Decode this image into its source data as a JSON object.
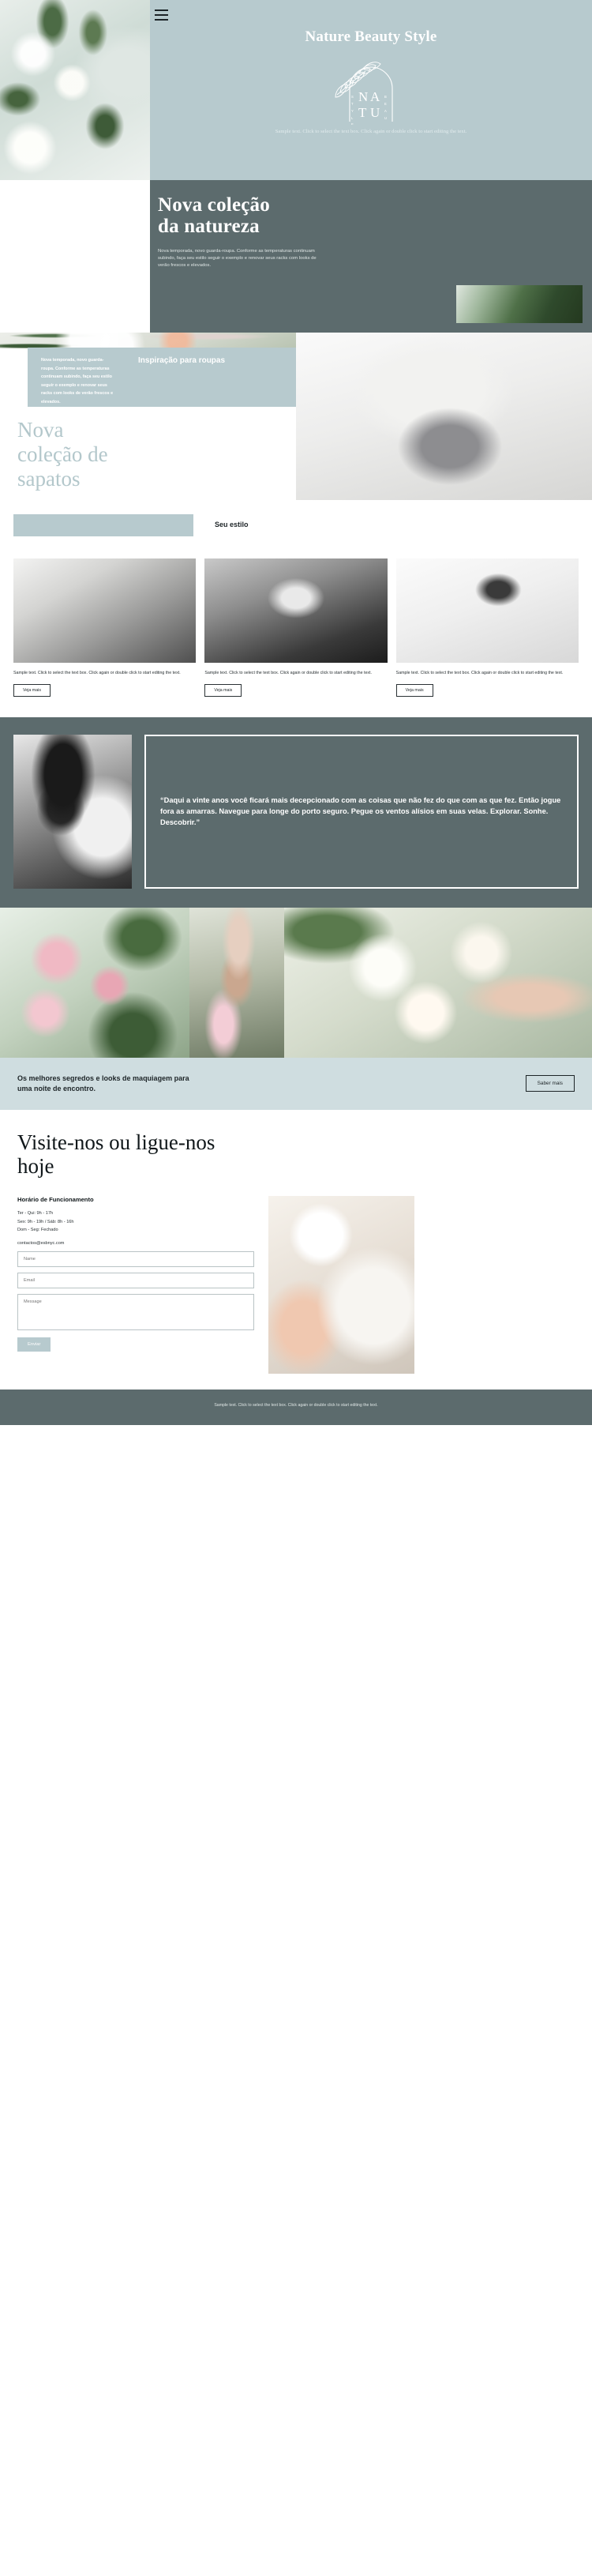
{
  "hero": {
    "menu_icon": "hamburger-menu-icon",
    "title": "Nature Beauty Style",
    "emblem": {
      "letters_center_top": "NA",
      "letters_center_bottom": "TU",
      "left_vertical": "STYLE",
      "right_vertical": "BEAUTY"
    },
    "sample_text": "Sample text. Click to select the text box. Click again or double click to start editing the text."
  },
  "section_nature": {
    "title_line1": "Nova coleção",
    "title_line2": "da natureza",
    "paragraph": "Nova temporada, novo guarda-roupa. Conforme as temperaturas continuam subindo, faça seu estilo seguir o exemplo e renovar seus racks com looks de verão frescos e elevados."
  },
  "section_shoes": {
    "band_text": "Nova temporada, novo guarda-roupa. Conforme as temperaturas continuam subindo, faça seu estilo seguir o exemplo e renovar seus racks com looks de verão frescos e elevados.",
    "band_title": "Inspiração para roupas",
    "heading_line1": "Nova",
    "heading_line2": "coleção de",
    "heading_line3": "sapatos"
  },
  "section_style": {
    "subtitle": "Seu estilo",
    "cards": [
      {
        "text": "Sample text. Click to select the text box. Click again or double click to start editing the text.",
        "button": "Veja mais"
      },
      {
        "text": "Sample text. Click to select the text box. Click again or double click to start editing the text.",
        "button": "Veja mais"
      },
      {
        "text": "Sample text. Click to select the text box. Click again or double click to start editing the text.",
        "button": "Veja mais"
      }
    ]
  },
  "section_quote": {
    "quote": "“Daqui a vinte anos você ficará mais decepcionado com as coisas que não fez do que com as que fez. Então jogue fora as amarras. Navegue para longe do porto seguro. Pegue os ventos alísios em suas velas. Explorar. Sonhe. Descobrir.”"
  },
  "section_makeup": {
    "text": "Os melhores segredos e looks de maquiagem para uma noite de encontro.",
    "button": "Saber mais"
  },
  "section_contact": {
    "title_line1": "Visite-nos ou ligue-nos",
    "title_line2": "hoje",
    "hours_heading": "Horário de Funcionamento",
    "hours": [
      "Ter - Qui: 9h - 17h",
      "Sex: 9h - 19h / Sáb: 8h - 16h",
      "Dom - Seg: Fechado"
    ],
    "email": "contactos@esbnyc.com",
    "form": {
      "name_placeholder": "Name",
      "email_placeholder": "Email",
      "message_placeholder": "Message",
      "submit_label": "Enviar"
    }
  },
  "footer": {
    "text": "Sample text. Click to select the text box. Click again or double click to start editing the text."
  },
  "colors": {
    "pale_blue": "#b7cace",
    "slate": "#5c6b6d",
    "light_band": "#cfdde0",
    "dark_text": "#10171a"
  }
}
